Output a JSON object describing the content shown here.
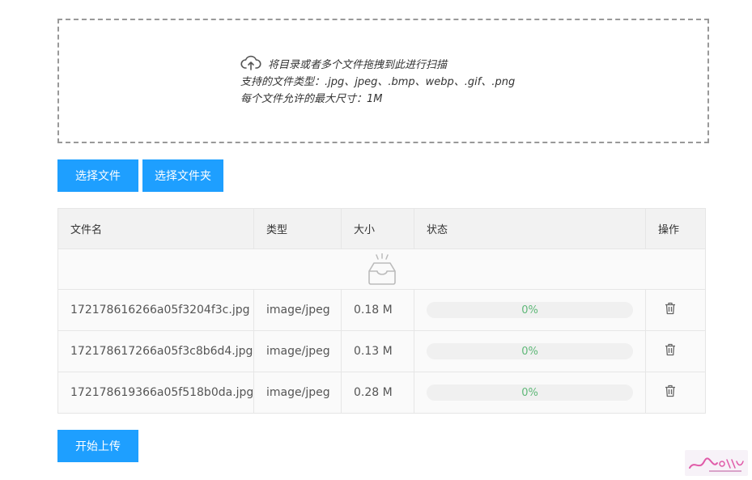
{
  "dropzone": {
    "hint": "将目录或者多个文件拖拽到此进行扫描",
    "types": "支持的文件类型：.jpg、jpeg、.bmp、webp、.gif、.png",
    "maxsize": "每个文件允许的最大尺寸：1M"
  },
  "buttons": {
    "select_file": "选择文件",
    "select_folder": "选择文件夹",
    "start_upload": "开始上传"
  },
  "table": {
    "headers": [
      "文件名",
      "类型",
      "大小",
      "状态",
      "操作"
    ],
    "rows": [
      {
        "name": "172178616266a05f3204f3c.jpg",
        "type": "image/jpeg",
        "size": "0.18 M",
        "status": "0%",
        "progress": 0
      },
      {
        "name": "172178617266a05f3c8b6d4.jpg",
        "type": "image/jpeg",
        "size": "0.13 M",
        "status": "0%",
        "progress": 0
      },
      {
        "name": "172178619366a05f518b0da.jpg",
        "type": "image/jpeg",
        "size": "0.28 M",
        "status": "0%",
        "progress": 0
      }
    ]
  },
  "colors": {
    "primary": "#1e9fff",
    "progress_text": "#5fb878"
  },
  "icons": [
    "cloud-upload-icon",
    "empty-inbox-icon",
    "trash-icon",
    "watermark-logo"
  ]
}
